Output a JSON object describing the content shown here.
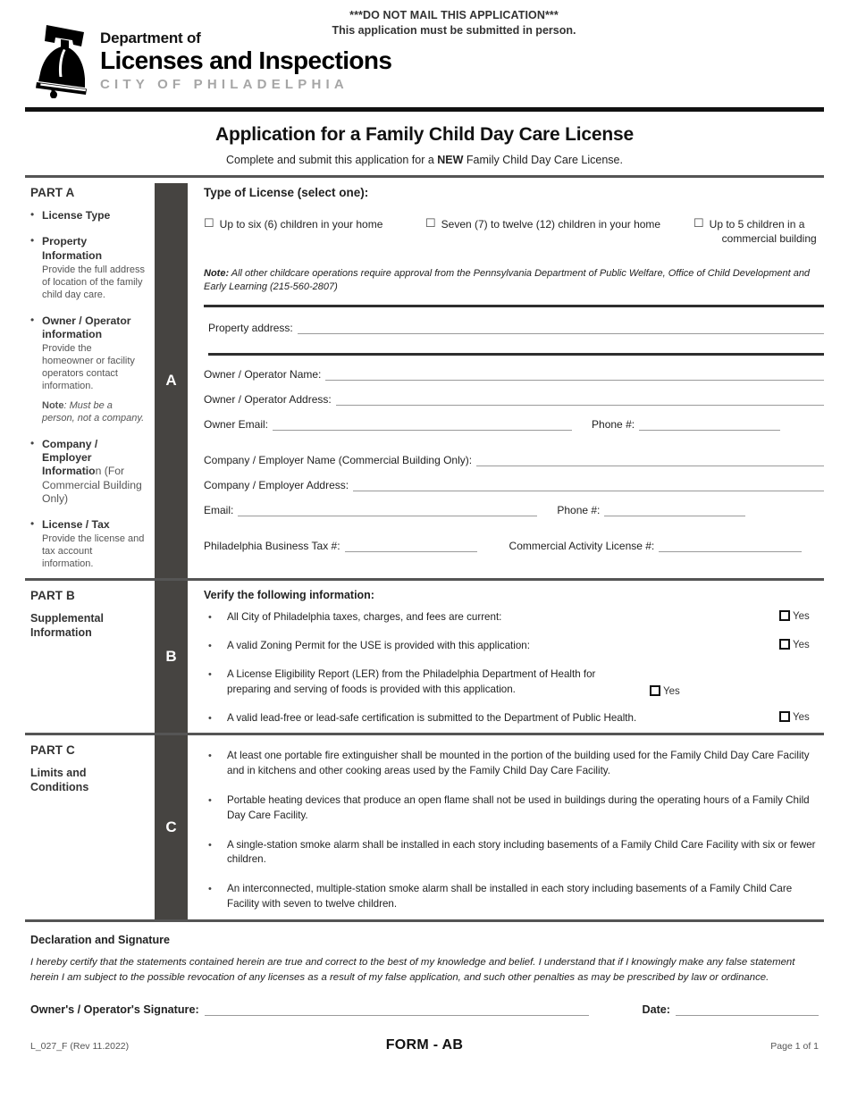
{
  "header": {
    "mail_notice_line1": "***DO NOT MAIL THIS APPLICATION***",
    "mail_notice_line2": "This application must be submitted in person.",
    "dept_line": "Department of",
    "agency_name": "Licenses and Inspections",
    "city_line": "CITY OF PHILADELPHIA",
    "logo_icon": "liberty-bell-icon"
  },
  "title_block": {
    "title": "Application for a Family Child Day Care License",
    "subtitle_before": "Complete and submit this application for a ",
    "subtitle_bold": "NEW",
    "subtitle_after": " Family Child Day Care License."
  },
  "part_a": {
    "part_label": "PART A",
    "tab_letter": "A",
    "sidebar": [
      {
        "head": "License Type",
        "head_regular": "",
        "desc": "",
        "note": ""
      },
      {
        "head": "Property Information",
        "head_regular": "",
        "desc": "Provide the full address of location of the family child day care.",
        "note": ""
      },
      {
        "head": "Owner / Operator information",
        "head_regular": "",
        "desc": "Provide the homeowner or facility operators contact information.",
        "note_bold": "Note",
        "note": ": Must be a person, not a company."
      },
      {
        "head": "Company / Employer Informatio",
        "head_regular": "n (For Commercial Building Only)",
        "desc": "",
        "note": ""
      },
      {
        "head": "License / Tax",
        "head_regular": "",
        "desc": "Provide the license and tax account information.",
        "note": ""
      }
    ],
    "section_title": "Type of License (select one):",
    "license_options": [
      {
        "label": "Up to six (6) children in your home",
        "label2": ""
      },
      {
        "label": "Seven (7) to twelve (12) children in your home",
        "label2": ""
      },
      {
        "label": "Up to 5 children in a",
        "label2": "commercial building"
      }
    ],
    "note_bold": "Note:",
    "note_text": " All other childcare operations require approval from the Pennsylvania Department of Public Welfare, Office of Child Development and Early Learning (215-560-2807)",
    "fields": {
      "property_address": "Property address:",
      "owner_name": "Owner / Operator Name:",
      "owner_address": "Owner / Operator Address:",
      "owner_email": "Owner Email:",
      "owner_phone": "Phone #:",
      "company_name": "Company / Employer Name (Commercial Building Only):",
      "company_address": "Company / Employer Address:",
      "company_email": "Email:",
      "company_phone": "Phone #:",
      "business_tax": "Philadelphia Business Tax #:",
      "activity_license": "Commercial Activity License #:"
    }
  },
  "part_b": {
    "part_label": "PART B",
    "part_sub": "Supplemental Information",
    "tab_letter": "B",
    "verify_title": "Verify the following information:",
    "yes_label": "Yes",
    "items": [
      "All City of Philadelphia taxes, charges, and fees are current:",
      "A valid Zoning Permit for the USE is provided with this application:",
      "A License Eligibility Report (LER) from the Philadelphia Department of Health for preparing and serving of foods is provided with this application.",
      "A valid lead-free or lead-safe certification is submitted to the Department of Public Health."
    ]
  },
  "part_c": {
    "part_label": "PART C",
    "part_sub": "Limits and Conditions",
    "tab_letter": "C",
    "items": [
      "At least one portable fire extinguisher shall be mounted in the portion of the building used for the Family Child Day Care Facility and in kitchens and other cooking areas used by the Family Child Day Care Facility.",
      "Portable heating devices that produce an open flame shall not be used in buildings during the operating hours of a Family Child Day Care Facility.",
      "A single-station smoke alarm shall be installed in each story including basements of a Family Child Care Facility with six or fewer children.",
      "An interconnected, multiple-station smoke alarm shall be installed in each story including basements of a Family Child Care Facility with seven to twelve children."
    ]
  },
  "declaration": {
    "heading": "Declaration and Signature",
    "body": "I hereby certify that the statements contained herein are true and correct to the best of my knowledge and belief. I understand that if I knowingly make any false statement herein I am subject to the possible revocation of any licenses as a result of my false application, and such other penalties as may be prescribed by law or ordinance.",
    "signature_label": "Owner's / Operator's Signature:",
    "date_label": "Date:"
  },
  "footer": {
    "form_id": "L_027_F (Rev 11.2022)",
    "form_name": "FORM - AB",
    "page_number": "Page 1 of 1"
  },
  "colors": {
    "tab_dark": "#464441",
    "city_grey": "#a6a6a6",
    "rule_black": "#111111"
  }
}
